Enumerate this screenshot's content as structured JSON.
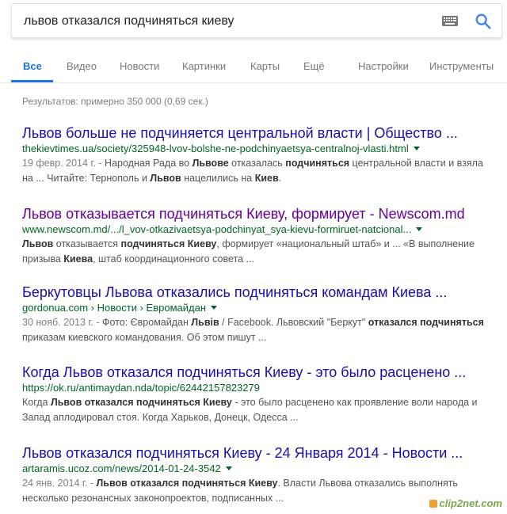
{
  "search": {
    "query": "львов отказался подчиняться киеву"
  },
  "tabs": [
    "Все",
    "Видео",
    "Новости",
    "Картинки",
    "Карты",
    "Ещё",
    "Настройки",
    "Инструменты"
  ],
  "stats": "Результатов: примерно 350 000 (0,69 сек.)",
  "results": [
    {
      "title": "Львов больше не подчиняется центральной власти | Общество ...",
      "url": "thekievtimes.ua/society/325948-lvov-bolshe-ne-podchinyaetsya-centralnoj-vlasti.html",
      "line1": [
        {
          "t": "19 февр. 2014 г. - ",
          "s": "date"
        },
        {
          "t": "Народная Рада во "
        },
        {
          "t": "Львове",
          "s": "b"
        },
        {
          "t": " отказалась "
        },
        {
          "t": "подчиняться",
          "s": "b"
        },
        {
          "t": " центральной власти и взяла"
        }
      ],
      "line2": [
        {
          "t": "на ... Читайте: Тернополь и "
        },
        {
          "t": "Львов",
          "s": "b"
        },
        {
          "t": " нацелились на "
        },
        {
          "t": "Киев",
          "s": "b"
        },
        {
          "t": "."
        }
      ]
    },
    {
      "title": "Львов отказывается подчиняться Киеву, формирует - Newscom.md",
      "visited": true,
      "url": "www.newscom.md/.../l_vov-otkazivaetsya-podchinyat_sya-kievu-formiruet-natcional...",
      "line1": [
        {
          "t": "Львов",
          "s": "b"
        },
        {
          "t": " отказывается "
        },
        {
          "t": "подчиняться",
          "s": "b"
        },
        {
          "t": " "
        },
        {
          "t": "Киеву",
          "s": "b"
        },
        {
          "t": ", формирует «национальный штаб» и ... «В выполнение"
        }
      ],
      "line2": [
        {
          "t": "призыва "
        },
        {
          "t": "Киева",
          "s": "b"
        },
        {
          "t": ", штаб координационного совета ..."
        }
      ]
    },
    {
      "title": "Беркутовцы Львова отказались подчиняться командам Киева ...",
      "url": "gordonua.com › Новости › Евромайдан",
      "line1": [
        {
          "t": "30 нояб. 2013 г. - ",
          "s": "date"
        },
        {
          "t": "Фото: Євромайдан "
        },
        {
          "t": "Львів",
          "s": "b"
        },
        {
          "t": " / Facebook. Львовский \"Беркут\" "
        },
        {
          "t": "отказался подчиняться",
          "s": "b"
        }
      ],
      "line2": [
        {
          "t": "приказам киевского командования. Об этом пишут ..."
        }
      ]
    },
    {
      "title": "Когда Львов отказался подчиняться Киеву - это было расценено ...",
      "url": "https://ok.ru/antimaydan.nda/topic/62442157823279",
      "noarrow": true,
      "line1": [
        {
          "t": "Когда "
        },
        {
          "t": "Львов отказался подчиняться Киеву",
          "s": "b"
        },
        {
          "t": " - это было расценено как проявление воли народа и"
        }
      ],
      "line2": [
        {
          "t": "Запад аплодировал стоя. Когда Харьков, Донецк, Одесса ..."
        }
      ]
    },
    {
      "title": "Львов отказался подчиняться Киеву - 24 Января 2014 - Новости ...",
      "url": "artaramis.ucoz.com/news/2014-01-24-3542",
      "line1": [
        {
          "t": "24 янв. 2014 г. - ",
          "s": "date"
        },
        {
          "t": "Львов отказался подчиняться Киеву",
          "s": "b"
        },
        {
          "t": ". Власти Львова отказались выполнять"
        }
      ],
      "line2": [
        {
          "t": "несколько резонансных законопроектов, подписанных ..."
        }
      ]
    }
  ],
  "watermark": "clip2net.com"
}
